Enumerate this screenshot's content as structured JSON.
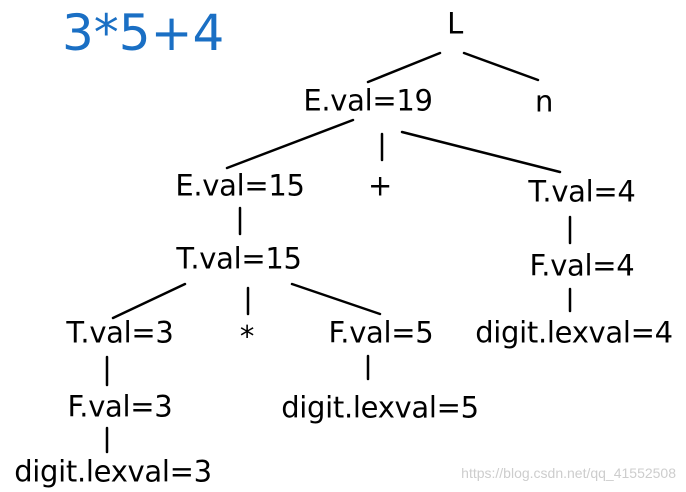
{
  "title": "3*5+4",
  "colors": {
    "title": "#1a6fc4",
    "text": "#000000",
    "edge": "#000000",
    "watermark": "#c8c8c8"
  },
  "nodes": {
    "root": "L",
    "e19": "E.val=19",
    "n": "n",
    "e15": "E.val=15",
    "plus": "+",
    "t4": "T.val=4",
    "t15": "T.val=15",
    "f4": "F.val=4",
    "t3": "T.val=3",
    "star": "*",
    "f5": "F.val=5",
    "digit4": "digit.lexval=4",
    "f3": "F.val=3",
    "digit5": "digit.lexval=5",
    "digit3": "digit.lexval=3"
  },
  "watermark": "https://blog.csdn.net/qq_41552508"
}
